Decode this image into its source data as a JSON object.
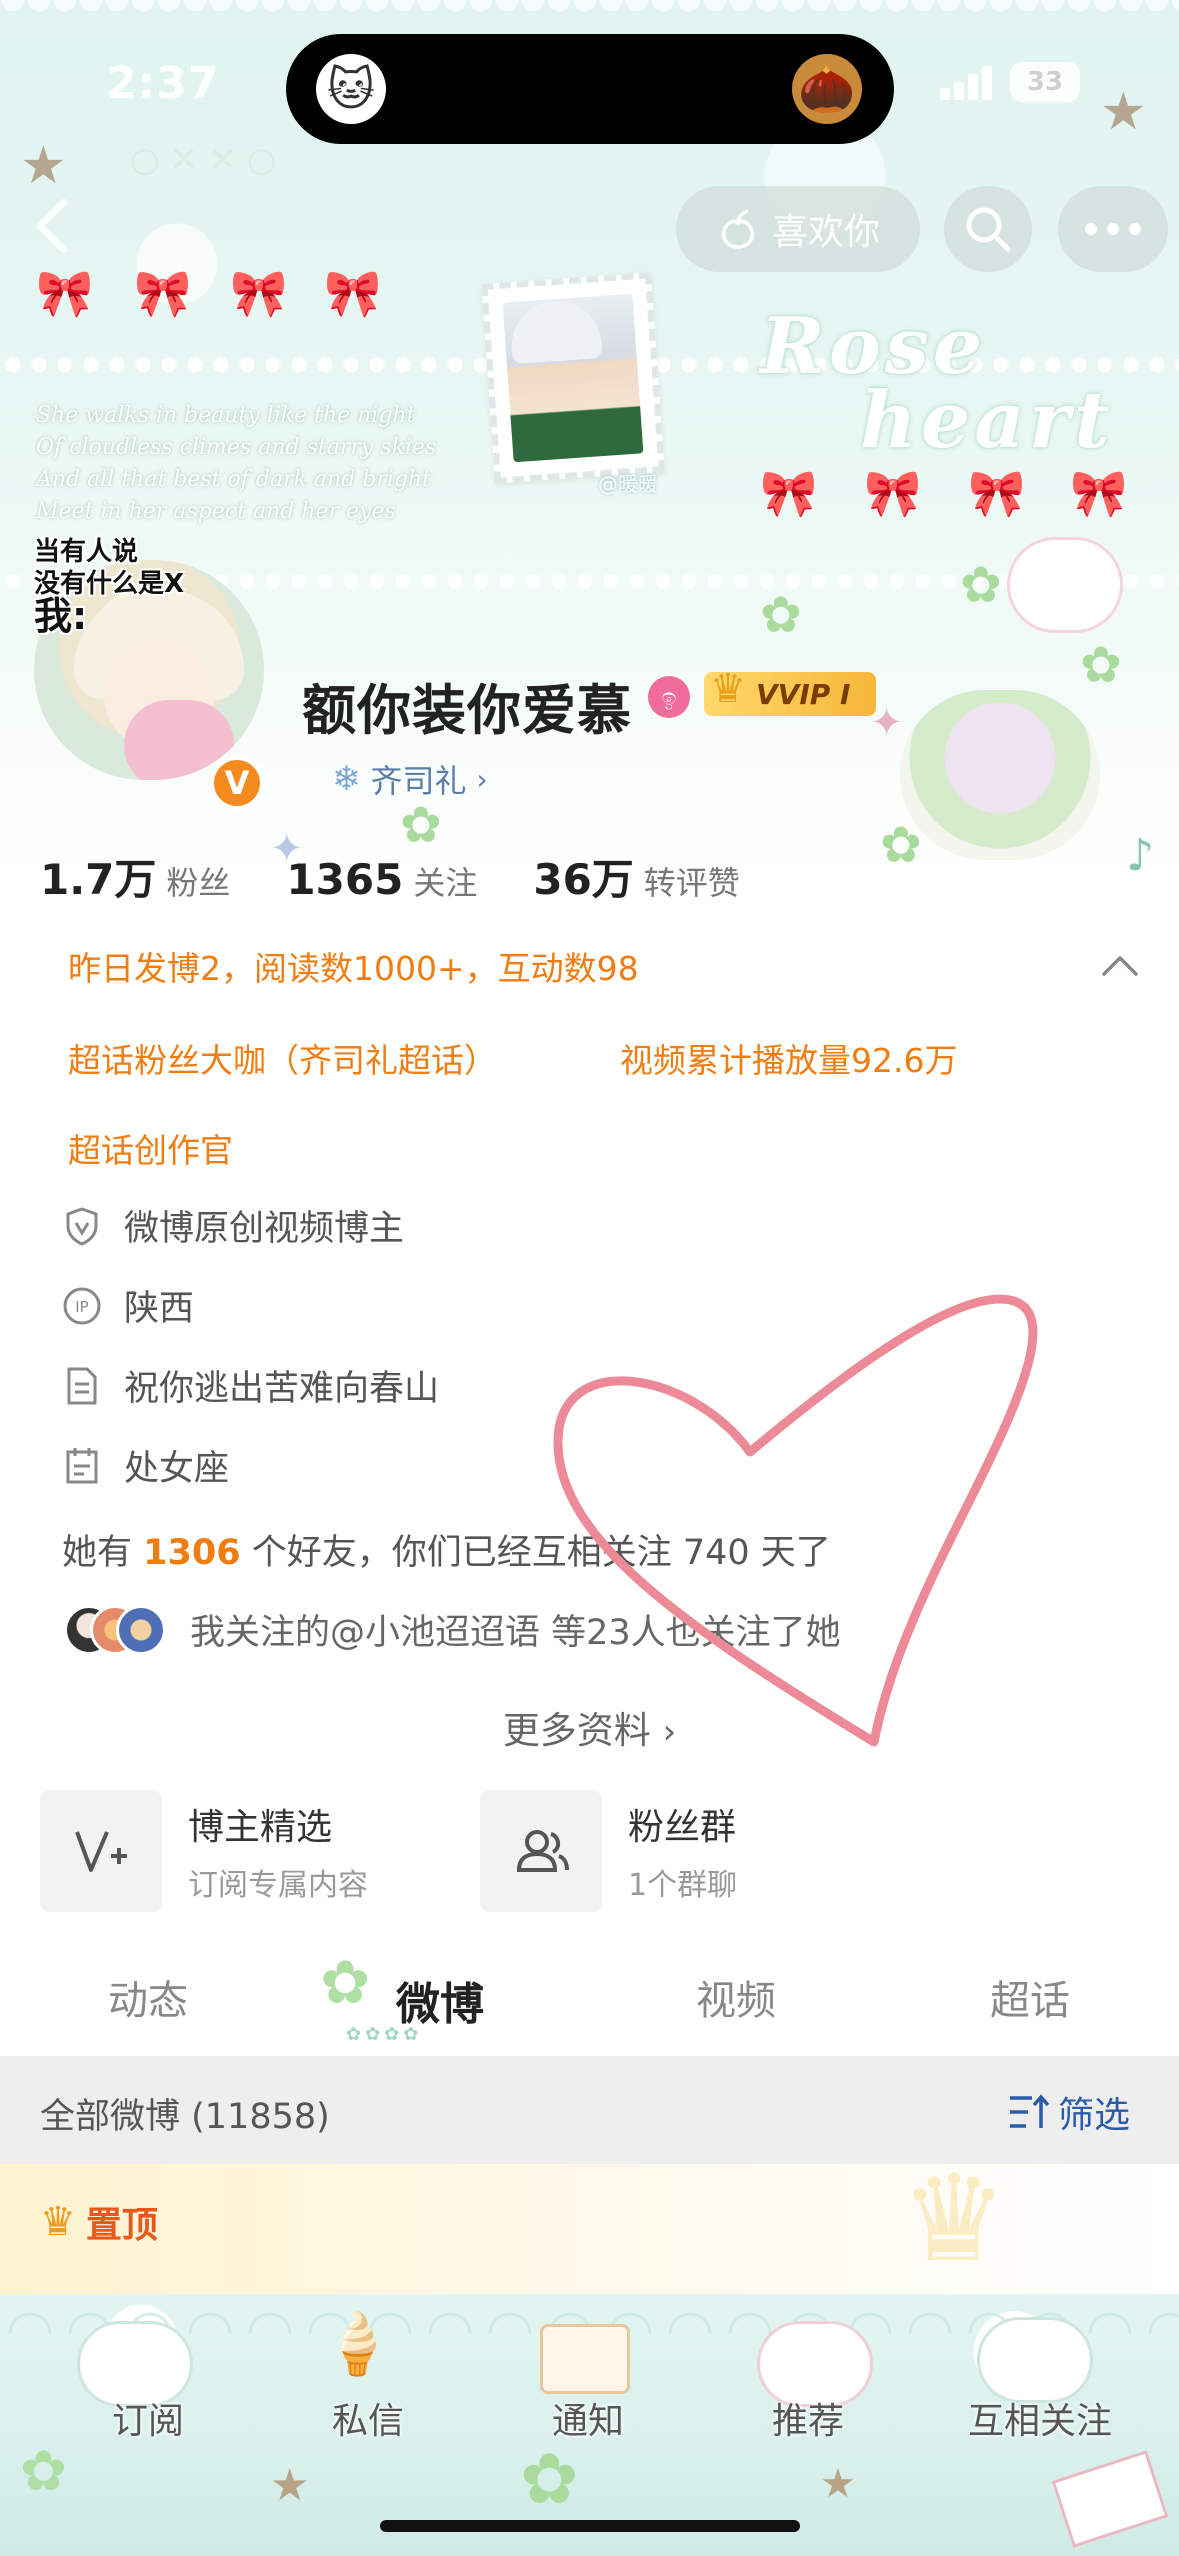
{
  "status_bar": {
    "time": "2:37",
    "battery": "33"
  },
  "header": {
    "like_label": "喜欢你",
    "poem": [
      "She walks in beauty like the night",
      "Of cloudless climes and starry skies",
      "And all that best of dark and bright",
      "Meet in her aspect and her eyes"
    ],
    "banner_title": [
      "Rose",
      "heart"
    ],
    "stamp_tag": "@暖暖",
    "sticker_text": [
      "当有人说",
      "没有什么是X",
      "我:"
    ]
  },
  "profile": {
    "name": "额你装你爱慕",
    "vip_label": "VVIP Ⅰ",
    "super_topic": "齐司礼",
    "stats": [
      {
        "num": "1.7万",
        "label": "粉丝"
      },
      {
        "num": "1365",
        "label": "关注"
      },
      {
        "num": "36万",
        "label": "转评赞"
      }
    ]
  },
  "info": {
    "yesterday": "昨日发博2，阅读数1000+，互动数98",
    "tag1": "超话粉丝大咖（齐司礼超话）",
    "tag2": "视频累计播放量92.6万",
    "tag3": "超话创作官",
    "rows": [
      {
        "icon": "shield-v-icon",
        "text": "微博原创视频博主"
      },
      {
        "icon": "ip-icon",
        "text": "陕西"
      },
      {
        "icon": "document-icon",
        "text": "祝你逃出苦难向春山"
      },
      {
        "icon": "calendar-icon",
        "text": "处女座"
      }
    ],
    "friends_prefix": "她有",
    "friends_count": "1306",
    "friends_suffix": "个好友，你们已经互相关注 740 天了",
    "mutual_follow": "我关注的@小池迢迢语 等23人也关注了她",
    "more_info": "更多资料"
  },
  "cards": [
    {
      "title": "博主精选",
      "subtitle": "订阅专属内容",
      "icon": "v-plus-icon"
    },
    {
      "title": "粉丝群",
      "subtitle": "1个群聊",
      "icon": "group-icon"
    }
  ],
  "tabs": [
    "动态",
    "微博",
    "视频",
    "超话"
  ],
  "active_tab": "微博",
  "feed": {
    "all_label": "全部微博 (11858)",
    "filter_label": "筛选",
    "pinned_label": "置顶"
  },
  "bottom_nav": [
    "订阅",
    "私信",
    "通知",
    "推荐",
    "互相关注"
  ],
  "colors": {
    "accent_orange": "#f07d12",
    "link_blue": "#2a5caa",
    "vvip_gold": "#f6b73a",
    "heart_pink": "#ec8a97"
  }
}
